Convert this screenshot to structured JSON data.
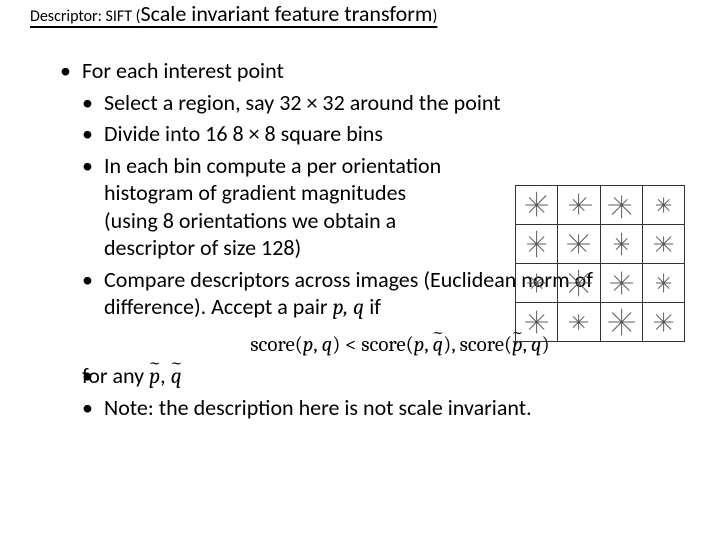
{
  "title": {
    "main": "Descriptor: SIFT (",
    "sub": "Scale invariant feature transform",
    "close": ")"
  },
  "bullets": {
    "b1": "For each interest point",
    "b2": "Select a region, say 32 × 32 around the point",
    "b3": "Divide into 16 8 × 8 square bins",
    "b4": "In each bin compute a per orientation histogram of gradient magnitudes (using 8 orientations we obtain a descriptor of size 128)",
    "b5": "Compare descriptors across images (Euclidean norm of difference). Accept a pair ",
    "b5_pq": "p, q",
    "b5_if": " if",
    "formula_1": "score(",
    "formula_p": "p",
    "formula_c": ", ",
    "formula_q": "q",
    "formula_2": ") < score(",
    "formula_qt": "q",
    "formula_3": "), score(",
    "formula_pt": "p",
    "formula_4": ")",
    "b6a": "for any ",
    "b6_pt": "p",
    "b6_c": ", ",
    "b6_qt": "q",
    "b7": "Note: the description here is not scale invariant."
  }
}
